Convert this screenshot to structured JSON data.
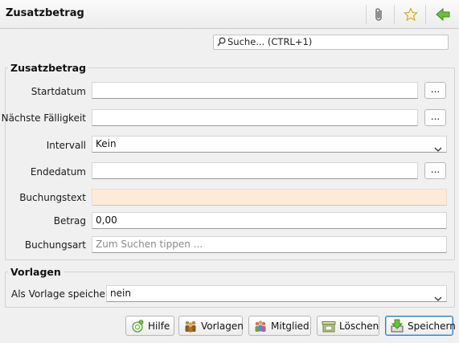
{
  "window": {
    "title": "Zusatzbetrag"
  },
  "toolbar": {
    "icons": [
      "paperclip-icon",
      "star-icon",
      "back-arrow-icon"
    ]
  },
  "search": {
    "placeholder": "Suche...",
    "shortcut": "Suche...  (CTRL+1)"
  },
  "section_main": {
    "title": "Zusatzbetrag",
    "fields": {
      "startdatum": {
        "label": "Startdatum",
        "value": "",
        "button": "..."
      },
      "naechste_faelligkeit": {
        "label": "Nächste Fälligkeit",
        "value": "",
        "button": "..."
      },
      "intervall": {
        "label": "Intervall",
        "value": "Kein"
      },
      "endedatum": {
        "label": "Endedatum",
        "value": "",
        "button": "..."
      },
      "buchungstext": {
        "label": "Buchungstext",
        "value": ""
      },
      "betrag": {
        "label": "Betrag",
        "value": "0,00"
      },
      "buchungsart": {
        "label": "Buchungsart",
        "placeholder": "Zum Suchen tippen ..."
      }
    }
  },
  "section_templates": {
    "title": "Vorlagen",
    "save_as_template": {
      "label": "Als Vorlage speichern",
      "value": "nein"
    }
  },
  "buttons": {
    "hilfe": "Hilfe",
    "vorlagen": "Vorlagen",
    "mitglied": "Mitglied",
    "loeschen": "Löschen",
    "speichern": "Speichern"
  },
  "colors": {
    "required_field_bg": "#fdebd9",
    "accent_green": "#5aa832",
    "primary_button_border": "#3c7fb1"
  }
}
